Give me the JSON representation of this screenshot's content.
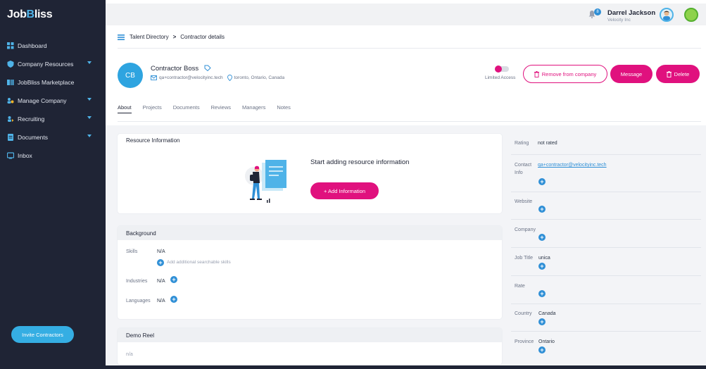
{
  "brand": {
    "logo_pre": "Job",
    "logo_b": "B",
    "logo_post": "liss"
  },
  "sidebar": {
    "items": [
      {
        "label": "Dashboard",
        "icon": "dashboard-icon"
      },
      {
        "label": "Company Resources",
        "icon": "shield-icon"
      },
      {
        "label": "JobBliss Marketplace",
        "icon": "marketplace-icon"
      },
      {
        "label": "Manage Company",
        "icon": "manage-company-icon"
      },
      {
        "label": "Recruiting",
        "icon": "recruiting-icon"
      },
      {
        "label": "Documents",
        "icon": "documents-icon"
      },
      {
        "label": "Inbox",
        "icon": "inbox-icon"
      }
    ],
    "invite_label": "Invite Contractors"
  },
  "topbar": {
    "notif_count": "8",
    "user_name": "Darrel Jackson",
    "user_org": "Velocity Inc"
  },
  "breadcrumb": {
    "root": "Talent Directory",
    "sep": ">",
    "current": "Contractor details"
  },
  "profile": {
    "initials": "CB",
    "name": "Contractor Boss",
    "email": "qa+contractor@velocityinc.tech",
    "location": "toronto, Ontario, Canada"
  },
  "actions": {
    "limited_access": "Limited Access",
    "remove": "Remove from company",
    "message": "Message",
    "delete": "Delete"
  },
  "tabs": [
    "About",
    "Projects",
    "Documents",
    "Reviews",
    "Managers",
    "Notes"
  ],
  "resource": {
    "title": "Resource Information",
    "start_text": "Start adding resource information",
    "add_label": "+ Add Information"
  },
  "background": {
    "title": "Background",
    "skills_label": "Skills",
    "skills_value": "N/A",
    "add_skills": "Add additional searchable skills",
    "industries_label": "Industries",
    "industries_value": "N/A",
    "languages_label": "Languages",
    "languages_value": "N/A"
  },
  "demo": {
    "title": "Demo Reel",
    "value": "n/a"
  },
  "side": {
    "rating_label": "Rating",
    "rating_value": "not rated",
    "contact_label": "Contact",
    "contact_label2": "Info",
    "contact_value": "qa+contractor@velocityinc.tech",
    "website_label": "Website",
    "company_label": "Company",
    "jobtitle_label": "Job Title",
    "jobtitle_value": "unica",
    "rate_label": "Rate",
    "country_label": "Country",
    "country_value": "Canada",
    "province_label": "Province",
    "province_value": "Ontario"
  },
  "colors": {
    "accent_pink": "#e0117e",
    "accent_blue": "#2f8fd6",
    "sidebar_bg": "#1f2435"
  }
}
